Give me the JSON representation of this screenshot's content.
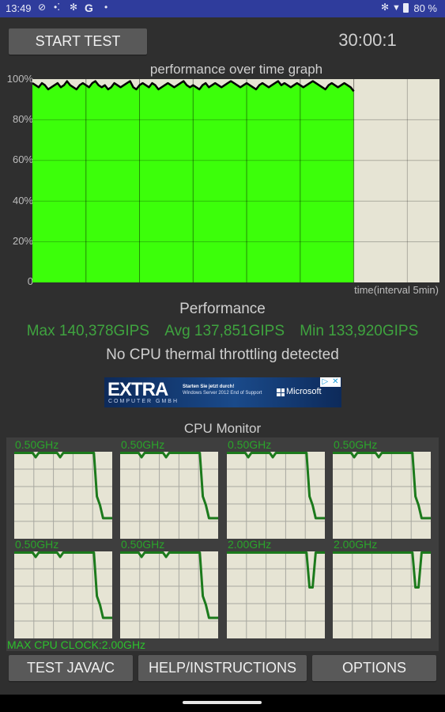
{
  "status_bar": {
    "time": "13:49",
    "left_icons": [
      "check-circle-icon",
      "assistant-dots-icon",
      "bluetooth-icon",
      "google-g-icon",
      "dot-icon"
    ],
    "right_icons": [
      "bluetooth-icon",
      "wifi-icon",
      "battery-icon"
    ],
    "battery": "80 %"
  },
  "header": {
    "start_button": "START TEST",
    "timer": "30:00:1"
  },
  "graph": {
    "title": "performance over time graph",
    "xlabel": "time(interval 5min)"
  },
  "chart_data": [
    {
      "type": "area",
      "title": "performance over time graph",
      "xlabel": "time(interval 5min)",
      "ylabel": "",
      "yticks": [
        "100%",
        "80%",
        "60%",
        "40%",
        "20%",
        "0"
      ],
      "ylim": [
        0,
        100
      ],
      "x_intervals_total": 7.6,
      "x_intervals_filled": 6,
      "grid": true,
      "fill_color": "#3cff0a",
      "line_color": "#000000",
      "values": [
        98,
        97,
        96,
        98,
        97,
        95,
        96,
        97,
        98,
        96,
        97,
        99,
        97,
        96,
        95,
        97,
        98,
        97,
        96,
        98,
        99,
        97,
        96,
        97,
        95,
        96,
        98,
        97,
        96,
        97,
        98,
        99,
        96,
        95,
        97,
        98,
        97,
        96,
        98,
        97,
        95,
        96,
        97,
        98,
        97,
        96,
        97,
        98,
        99,
        97,
        96,
        97,
        96,
        95,
        97,
        98,
        96,
        97,
        98,
        97,
        96,
        97,
        98,
        99,
        98,
        97,
        96,
        97,
        98,
        97,
        96,
        95,
        97,
        98,
        97,
        96,
        97,
        98,
        99,
        97,
        98,
        97,
        96,
        97,
        98,
        97,
        96,
        97,
        98,
        99,
        98,
        97,
        96,
        95,
        97,
        98,
        97,
        96,
        97,
        98,
        97,
        96,
        94
      ]
    },
    {
      "type": "line",
      "title": "CPU Monitor",
      "ylim": [
        0,
        2.0
      ],
      "grid": true,
      "line_color": "#1c7a1c",
      "cores": [
        {
          "label": "0.50GHz",
          "values": [
            2.0,
            2.0,
            2.0,
            2.0,
            2.0,
            2.0,
            2.0,
            1.9,
            2.0,
            2.0,
            2.0,
            2.0,
            2.0,
            2.0,
            2.0,
            1.9,
            2.0,
            2.0,
            2.0,
            2.0,
            2.0,
            2.0,
            2.0,
            2.0,
            2.0,
            2.0,
            2.0,
            1.0,
            0.8,
            0.5,
            0.5,
            0.5,
            0.5
          ]
        },
        {
          "label": "0.50GHz",
          "values": [
            2.0,
            2.0,
            2.0,
            2.0,
            2.0,
            2.0,
            2.0,
            1.9,
            2.0,
            2.0,
            2.0,
            2.0,
            2.0,
            2.0,
            2.0,
            1.9,
            2.0,
            2.0,
            2.0,
            2.0,
            2.0,
            2.0,
            2.0,
            2.0,
            2.0,
            2.0,
            2.0,
            1.0,
            0.8,
            0.5,
            0.5,
            0.5,
            0.5
          ]
        },
        {
          "label": "0.50GHz",
          "values": [
            2.0,
            2.0,
            2.0,
            2.0,
            2.0,
            2.0,
            2.0,
            1.9,
            2.0,
            2.0,
            2.0,
            2.0,
            2.0,
            2.0,
            2.0,
            1.9,
            2.0,
            2.0,
            2.0,
            2.0,
            2.0,
            2.0,
            2.0,
            2.0,
            2.0,
            2.0,
            2.0,
            1.0,
            0.8,
            0.5,
            0.5,
            0.5,
            0.5
          ]
        },
        {
          "label": "0.50GHz",
          "values": [
            2.0,
            2.0,
            2.0,
            2.0,
            2.0,
            2.0,
            2.0,
            1.9,
            2.0,
            2.0,
            2.0,
            2.0,
            2.0,
            2.0,
            2.0,
            1.9,
            2.0,
            2.0,
            2.0,
            2.0,
            2.0,
            2.0,
            2.0,
            2.0,
            2.0,
            2.0,
            2.0,
            1.0,
            0.8,
            0.5,
            0.5,
            0.5,
            0.5
          ]
        },
        {
          "label": "0.50GHz",
          "values": [
            2.0,
            2.0,
            2.0,
            2.0,
            2.0,
            2.0,
            2.0,
            1.9,
            2.0,
            2.0,
            2.0,
            2.0,
            2.0,
            2.0,
            2.0,
            1.9,
            2.0,
            2.0,
            2.0,
            2.0,
            2.0,
            2.0,
            2.0,
            2.0,
            2.0,
            2.0,
            2.0,
            1.0,
            0.8,
            0.5,
            0.5,
            0.5,
            0.5
          ]
        },
        {
          "label": "0.50GHz",
          "values": [
            2.0,
            2.0,
            2.0,
            2.0,
            2.0,
            2.0,
            2.0,
            1.9,
            2.0,
            2.0,
            2.0,
            2.0,
            2.0,
            2.0,
            2.0,
            1.9,
            2.0,
            2.0,
            2.0,
            2.0,
            2.0,
            2.0,
            2.0,
            2.0,
            2.0,
            2.0,
            2.0,
            1.0,
            0.8,
            0.5,
            0.5,
            0.5,
            0.5
          ]
        },
        {
          "label": "2.00GHz",
          "values": [
            2.0,
            2.0,
            2.0,
            2.0,
            2.0,
            2.0,
            2.0,
            2.0,
            2.0,
            2.0,
            2.0,
            2.0,
            2.0,
            2.0,
            2.0,
            2.0,
            2.0,
            2.0,
            2.0,
            2.0,
            2.0,
            2.0,
            2.0,
            2.0,
            2.0,
            2.0,
            2.0,
            1.2,
            1.2,
            2.0,
            2.0,
            2.0,
            2.0
          ]
        },
        {
          "label": "2.00GHz",
          "values": [
            2.0,
            2.0,
            2.0,
            2.0,
            2.0,
            2.0,
            2.0,
            2.0,
            2.0,
            2.0,
            2.0,
            2.0,
            2.0,
            2.0,
            2.0,
            2.0,
            2.0,
            2.0,
            2.0,
            2.0,
            2.0,
            2.0,
            2.0,
            2.0,
            2.0,
            2.0,
            2.0,
            1.2,
            1.2,
            2.0,
            2.0,
            2.0,
            2.0
          ]
        }
      ]
    }
  ],
  "performance": {
    "title": "Performance",
    "max": "Max 140,378GIPS",
    "avg": "Avg 137,851GIPS",
    "min": "Min 133,920GIPS",
    "throttling": "No CPU thermal throttling detected",
    "stats_color": "#3fa33f"
  },
  "ad": {
    "brand": "EXTRA",
    "brand_sub": "COMPUTER GMBH",
    "line1": "Starten Sie jetzt durch!",
    "line2": "Windows Server 2012 End of Support",
    "partner": "Microsoft"
  },
  "cpu_monitor": {
    "title": "CPU Monitor",
    "max_clock": "MAX CPU CLOCK:2.00GHz"
  },
  "bottom_buttons": {
    "test": "TEST JAVA/C",
    "help": "HELP/INSTRUCTIONS",
    "options": "OPTIONS"
  }
}
